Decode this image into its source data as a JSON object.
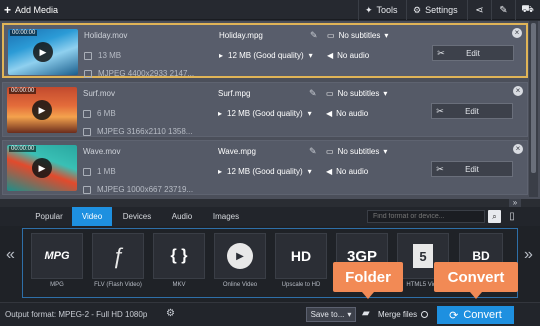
{
  "toolbar": {
    "add_media": "Add Media",
    "tools": "Tools",
    "settings": "Settings"
  },
  "files": [
    {
      "duration": "00:00:00",
      "src_name": "Holiday.mov",
      "src_size": "13 MB",
      "src_meta": "MJPEG 4400x2933 2147...",
      "dst_name": "Holiday.mpg",
      "dst_size": "12 MB (Good quality)",
      "subtitles": "No subtitles",
      "audio": "No audio",
      "edit": "Edit",
      "selected": true
    },
    {
      "duration": "00:00:00",
      "src_name": "Surf.mov",
      "src_size": "6 MB",
      "src_meta": "MJPEG 3166x2110 1358...",
      "dst_name": "Surf.mpg",
      "dst_size": "12 MB (Good quality)",
      "subtitles": "No subtitles",
      "audio": "No audio",
      "edit": "Edit",
      "selected": false
    },
    {
      "duration": "00:00:00",
      "src_name": "Wave.mov",
      "src_size": "1 MB",
      "src_meta": "MJPEG 1000x667 23719...",
      "dst_name": "Wave.mpg",
      "dst_size": "12 MB (Good quality)",
      "subtitles": "No subtitles",
      "audio": "No audio",
      "edit": "Edit",
      "selected": false
    }
  ],
  "format_tabs": [
    "Popular",
    "Video",
    "Devices",
    "Audio",
    "Images"
  ],
  "active_tab": "Video",
  "format_search_placeholder": "Find format or device...",
  "formats": [
    {
      "badge": "MPG",
      "label": "MPG"
    },
    {
      "badge": "ƒ",
      "label": "FLV (Flash Video)"
    },
    {
      "badge": "{ }",
      "label": "MKV"
    },
    {
      "badge": "▶",
      "label": "Online Video"
    },
    {
      "badge": "HD",
      "label": "Upscale to HD"
    },
    {
      "badge": "3GP",
      "label": ""
    },
    {
      "badge": "5",
      "label": "HTML5 Vide"
    },
    {
      "badge": "BD",
      "label": ""
    }
  ],
  "bottom": {
    "output_format": "Output format: MPEG-2 - Full HD 1080p",
    "save_to": "Save to...",
    "merge_files": "Merge files",
    "convert": "Convert"
  },
  "callouts": {
    "folder": "Folder",
    "convert": "Convert"
  },
  "colors": {
    "accent": "#1e90e0",
    "callout": "#f28a55",
    "selection": "#e0b457"
  }
}
